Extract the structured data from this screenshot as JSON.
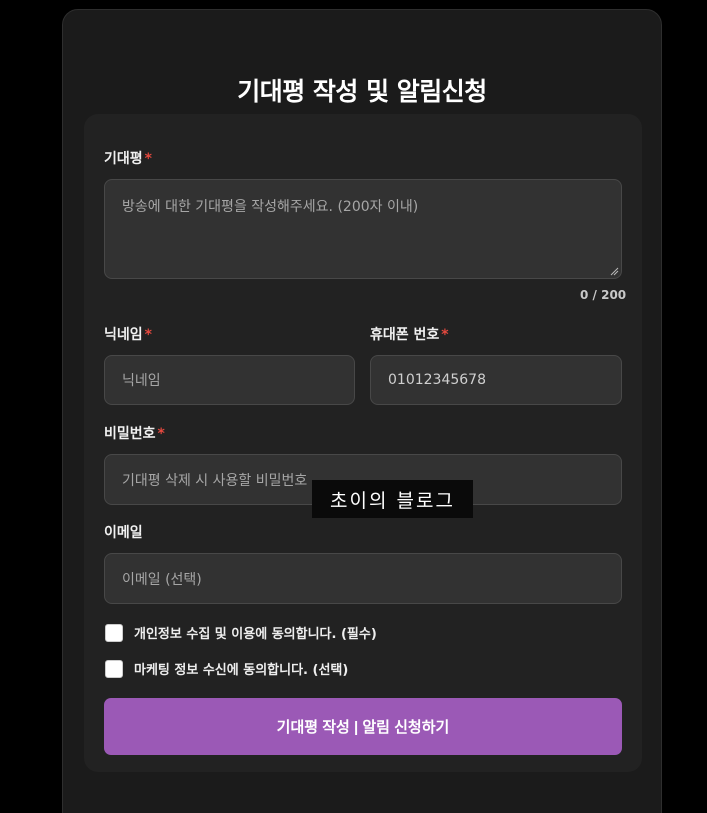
{
  "form": {
    "title": "기대평 작성 및 알림신청",
    "review": {
      "label": "기대평",
      "required_mark": "*",
      "placeholder": "방송에 대한 기대평을 작성해주세요. (200자 이내)",
      "counter": "0 / 200"
    },
    "nickname": {
      "label": "닉네임",
      "required_mark": "*",
      "placeholder": "닉네임"
    },
    "phone": {
      "label": "휴대폰 번호",
      "required_mark": "*",
      "value": "01012345678"
    },
    "password": {
      "label": "비밀번호",
      "required_mark": "*",
      "placeholder": "기대평 삭제 시 사용할 비밀번호"
    },
    "email": {
      "label": "이메일",
      "placeholder": "이메일 (선택)"
    },
    "consent_privacy": {
      "label": "개인정보 수집 및 이용에 동의합니다. (필수)",
      "checked": false
    },
    "consent_marketing": {
      "label": "마케팅 정보 수신에 동의합니다. (선택)",
      "checked": false
    },
    "submit_label": "기대평 작성 | 알림 신청하기"
  },
  "watermark": "초이의 블로그",
  "colors": {
    "page_bg": "#000000",
    "card_bg": "#1b1b1b",
    "panel_bg": "#222222",
    "field_bg": "#323232",
    "required": "#e5493f",
    "accent": "#9b59b6"
  }
}
